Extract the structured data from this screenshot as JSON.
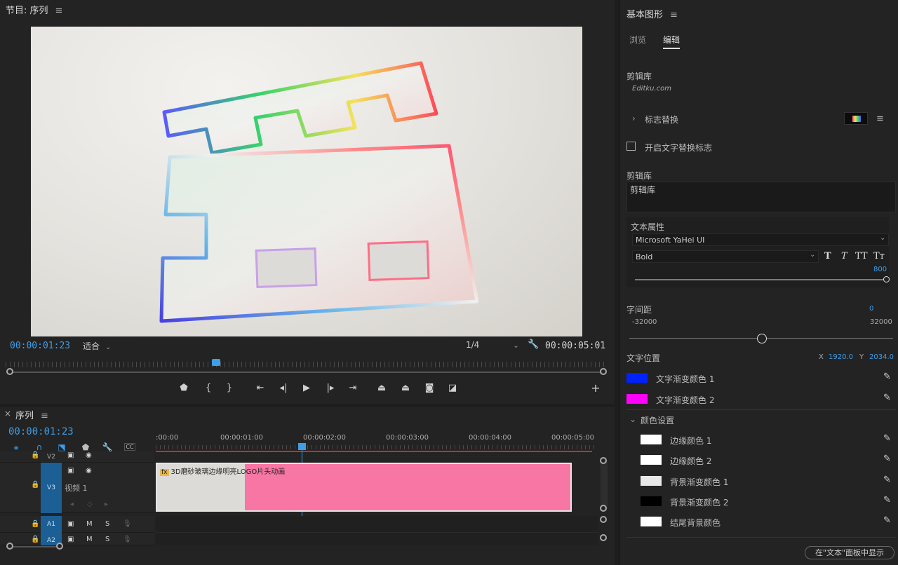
{
  "monitor": {
    "title": "节目: 序列",
    "timecode_current": "00:00:01:23",
    "fit": "适合",
    "resolution": "1/4",
    "timecode_duration": "00:00:05:01"
  },
  "timeline": {
    "title": "序列",
    "timecode": "00:00:01:23",
    "ruler_labels": [
      ":00:00",
      "00:00:01:00",
      "00:00:02:00",
      "00:00:03:00",
      "00:00:04:00",
      "00:00:05:00"
    ],
    "tracks": {
      "v2": "V2",
      "v3": "V3",
      "v1_label": "视频 1",
      "a1": "A1",
      "a2": "A2",
      "m": "M",
      "s": "S"
    },
    "clip_label": "3D磨砂玻璃边缘明亮LOGO片头动画",
    "clip_fx": "fx"
  },
  "eg": {
    "title": "基本图形",
    "tabs": {
      "browse": "浏览",
      "edit": "编辑"
    },
    "library_label": "剪辑库",
    "library_sub": "Editku.com",
    "logo_replace": "标志替换",
    "checkbox_label": "开启文字替换标志",
    "library_label2": "剪辑库",
    "library_text": "剪辑库",
    "text_props": "文本属性",
    "font": "Microsoft YaHei UI",
    "style": "Bold",
    "size": "800",
    "tracking_label": "字间距",
    "tracking_value": "0",
    "tracking_min": "-32000",
    "tracking_max": "32000",
    "pos_label": "文字位置",
    "pos_x_label": "X",
    "pos_x": "1920.0",
    "pos_y_label": "Y",
    "pos_y": "2034.0",
    "grad1": "文字渐变颜色 1",
    "grad2": "文字渐变颜色 2",
    "color_settings": "颜色设置",
    "edge1": "边缘颜色 1",
    "edge2": "边缘颜色 2",
    "bg1": "背景渐变颜色 1",
    "bg2": "背景渐变颜色 2",
    "end_bg": "结尾背景颜色",
    "show_in_text": "在\"文本\"面板中显示"
  },
  "colors": {
    "accent": "#3d9ee8",
    "grad1": "#0022ff",
    "grad2": "#ff00ff",
    "edge1": "#ffffff",
    "edge2": "#ffffff",
    "bg1": "#e8e8e8",
    "bg2": "#000000",
    "end_bg": "#ffffff",
    "clip": "#f876a3"
  }
}
